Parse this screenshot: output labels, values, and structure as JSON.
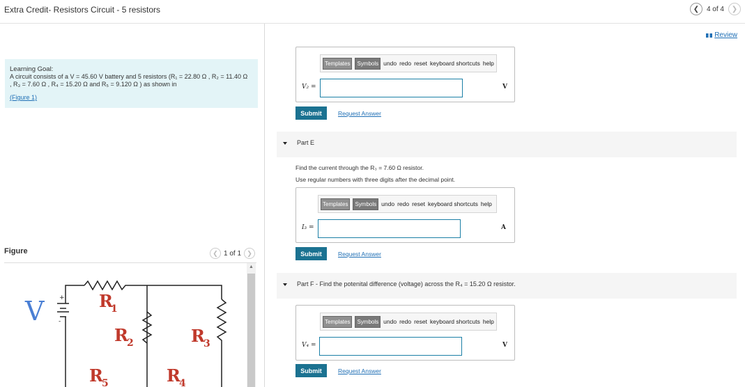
{
  "header": {
    "title": "Extra Credit- Resistors Circuit - 5 resistors",
    "page_text": "4 of 4",
    "prev_icon": "chevron-left-icon",
    "next_icon": "chevron-right-icon"
  },
  "review_link": "Review",
  "learning_goal": {
    "heading": "Learning Goal:",
    "line1": "A circuit consists of a V = 45.60 V battery and 5 resistors (R₁ = 22.80 Ω , R₂ = 11.40 Ω",
    "line2": ", R₃ = 7.60 Ω , R₄ = 15.20 Ω and R₅ = 9.120 Ω ) as shown in",
    "figure_link": "(Figure 1)"
  },
  "figure": {
    "label": "Figure",
    "pager_text": "1 of 1",
    "labels": {
      "v": "V",
      "r1": "R",
      "r1s": "1",
      "r2": "R",
      "r2s": "2",
      "r3": "R",
      "r3s": "3",
      "r4": "R",
      "r4s": "4",
      "r5": "R",
      "r5s": "5",
      "plus": "+",
      "minus": "-"
    }
  },
  "toolbar": {
    "templates": "Templates",
    "symbols": "Symbols",
    "undo": "undo",
    "redo": "redo",
    "reset": "reset",
    "shortcuts": "keyboard shortcuts",
    "help": "help"
  },
  "part_d": {
    "var_label": "V₂ =",
    "input_value": "",
    "unit": "V",
    "submit": "Submit",
    "request": "Request Answer"
  },
  "part_e": {
    "title": "Part E",
    "question": "Find the current through the R₃ = 7.60 Ω resistor.",
    "instruction": "Use regular numbers with three digits after the decimal point.",
    "var_label": "I₃ =",
    "input_value": "",
    "unit": "A",
    "submit": "Submit",
    "request": "Request Answer"
  },
  "part_f": {
    "title": "Part F - Find the potenital difference (voltage) across the R₄ = 15.20 Ω resistor.",
    "var_label": "V₄ =",
    "input_value": "",
    "unit": "V",
    "submit": "Submit",
    "request": "Request Answer"
  },
  "colors": {
    "accent": "#1b7291",
    "link": "#1f6fb5",
    "goal_bg": "#e3f4f7",
    "circuit_label": "#c0392b",
    "voltage": "#4a7fd4"
  }
}
